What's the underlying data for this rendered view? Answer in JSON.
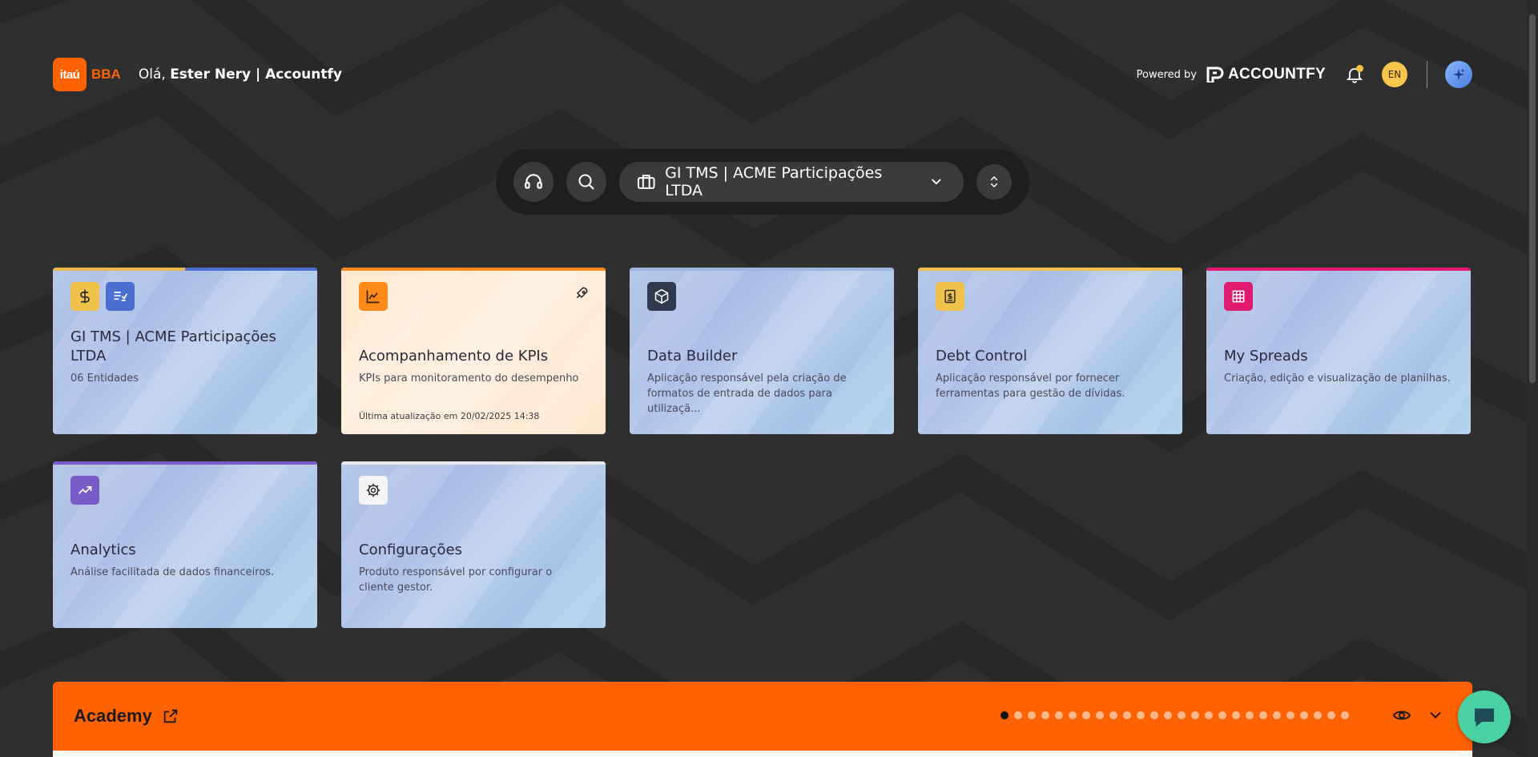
{
  "header": {
    "logo_text": "itaú",
    "logo_sub": "BBA",
    "greeting_prefix": "Olá,",
    "greeting_name": "Ester Nery | Accountfy",
    "powered_by": "Powered by",
    "accountfy_brand": "ACCOUNTFY",
    "language": "EN"
  },
  "toolbar": {
    "company": "GI TMS | ACME Participações LTDA"
  },
  "cards": [
    {
      "title": "GI TMS | ACME Participações LTDA",
      "desc": "06 Entidades"
    },
    {
      "title": "Acompanhamento de KPIs",
      "desc": "KPIs para monitoramento do desempenho",
      "foot": "Última atualização em 20/02/2025 14:38"
    },
    {
      "title": "Data Builder",
      "desc": "Aplicação responsável pela criação de formatos de entrada de dados para utilizaçã..."
    },
    {
      "title": "Debt Control",
      "desc": "Aplicação responsável por fornecer ferramentas para gestão de dívidas."
    },
    {
      "title": "My Spreads",
      "desc": "Criação, edição e visualização de planilhas."
    },
    {
      "title": "Analytics",
      "desc": "Análise facilitada de dados financeiros."
    },
    {
      "title": "Configurações",
      "desc": "Produto responsável por configurar o cliente gestor."
    }
  ],
  "academy": {
    "title": "Academy",
    "slide_count": 26,
    "active_slide": 1
  },
  "colors": {
    "brand_orange": "#ff6200",
    "background": "#2f2f2f",
    "chat": "#4ad0a5"
  }
}
